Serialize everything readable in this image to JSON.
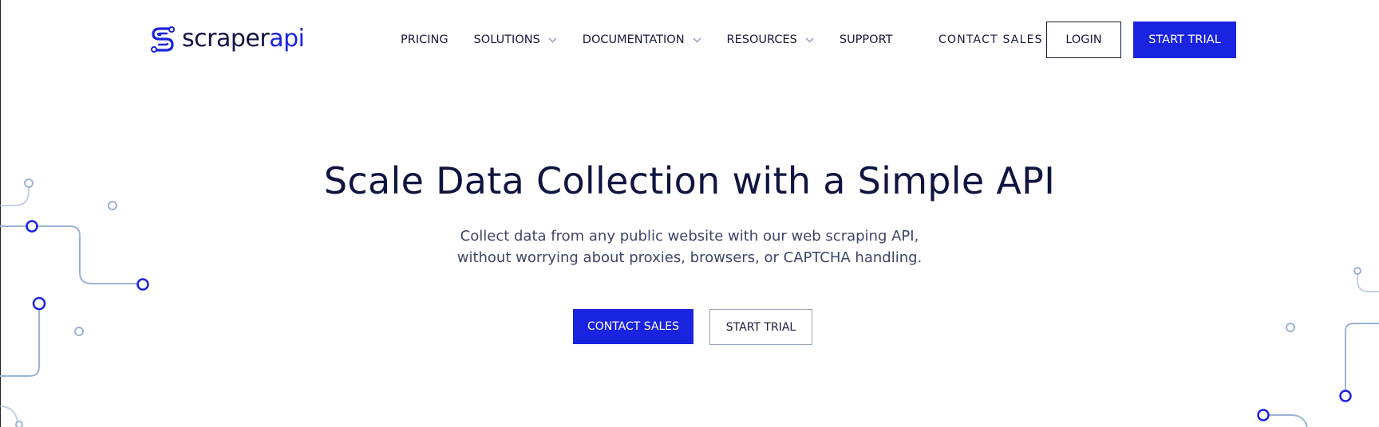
{
  "brand": {
    "name_main": "scraper",
    "name_accent": "api",
    "accent_color": "#1a23e0",
    "text_color": "#0f1440",
    "icon": "scraperapi-s-logo-icon"
  },
  "nav": {
    "items": [
      {
        "label": "PRICING",
        "has_dropdown": false
      },
      {
        "label": "SOLUTIONS",
        "has_dropdown": true
      },
      {
        "label": "DOCUMENTATION",
        "has_dropdown": true
      },
      {
        "label": "RESOURCES",
        "has_dropdown": true
      },
      {
        "label": "SUPPORT",
        "has_dropdown": false
      }
    ],
    "dropdown_icon": "chevron-down-icon"
  },
  "header_actions": {
    "contact_label": "CONTACT SALES",
    "login_label": "LOGIN",
    "trial_label": "START TRIAL"
  },
  "hero": {
    "title": "Scale Data Collection with a Simple API",
    "subtitle_line1": "Collect data from any public website with our web scraping API,",
    "subtitle_line2": "without worrying about proxies, browsers, or CAPTCHA handling.",
    "primary_cta": "CONTACT SALES",
    "secondary_cta": "START TRIAL"
  },
  "decoration": {
    "circuit_line_color": "#9db3d6",
    "node_color": "#1a23e0"
  }
}
